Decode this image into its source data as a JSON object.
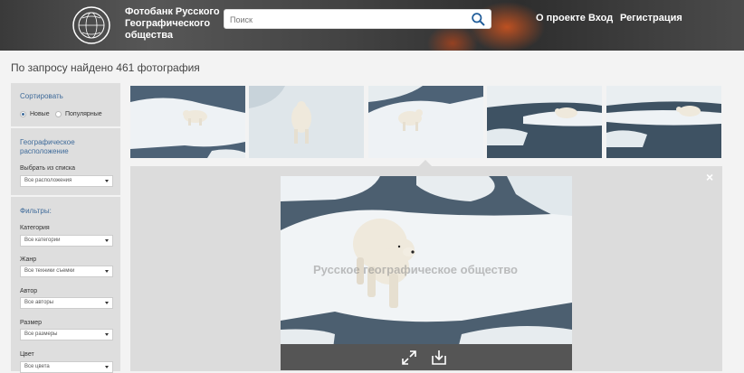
{
  "header": {
    "brand_lines": [
      "Фотобанк Русского",
      "Географического",
      "общества"
    ],
    "search_placeholder": "Поиск",
    "nav": [
      "О проекте",
      "Вход",
      "Регистрация"
    ],
    "accent": "#d6561f"
  },
  "result_text": "По запросу найдено 461 фотография",
  "sidebar": {
    "sort_title": "Сортировать",
    "sort_options": [
      "Новые",
      "Популярные"
    ],
    "sort_selected": "Новые",
    "geo_title": "Географическое расположение",
    "geo_label": "Выбрать из списка",
    "geo_select": "Все расположения",
    "filters_title": "Фильтры:",
    "filters": [
      {
        "label": "Категория",
        "value": "Все категории"
      },
      {
        "label": "Жанр",
        "value": "Все техники съемки"
      },
      {
        "label": "Автор",
        "value": "Все авторы"
      },
      {
        "label": "Размер",
        "value": "Все размеры"
      },
      {
        "label": "Цвет",
        "value": "Все цвета"
      }
    ],
    "title_color": "#3f6b9a"
  },
  "thumbnails": [
    {
      "name": "polar-bear-1"
    },
    {
      "name": "polar-bear-2"
    },
    {
      "name": "polar-bear-3"
    },
    {
      "name": "polar-bear-4"
    },
    {
      "name": "polar-bear-5"
    }
  ],
  "preview": {
    "watermark": "Русское географическое общество",
    "close": "×",
    "actions": [
      "expand-icon",
      "download-icon"
    ]
  }
}
